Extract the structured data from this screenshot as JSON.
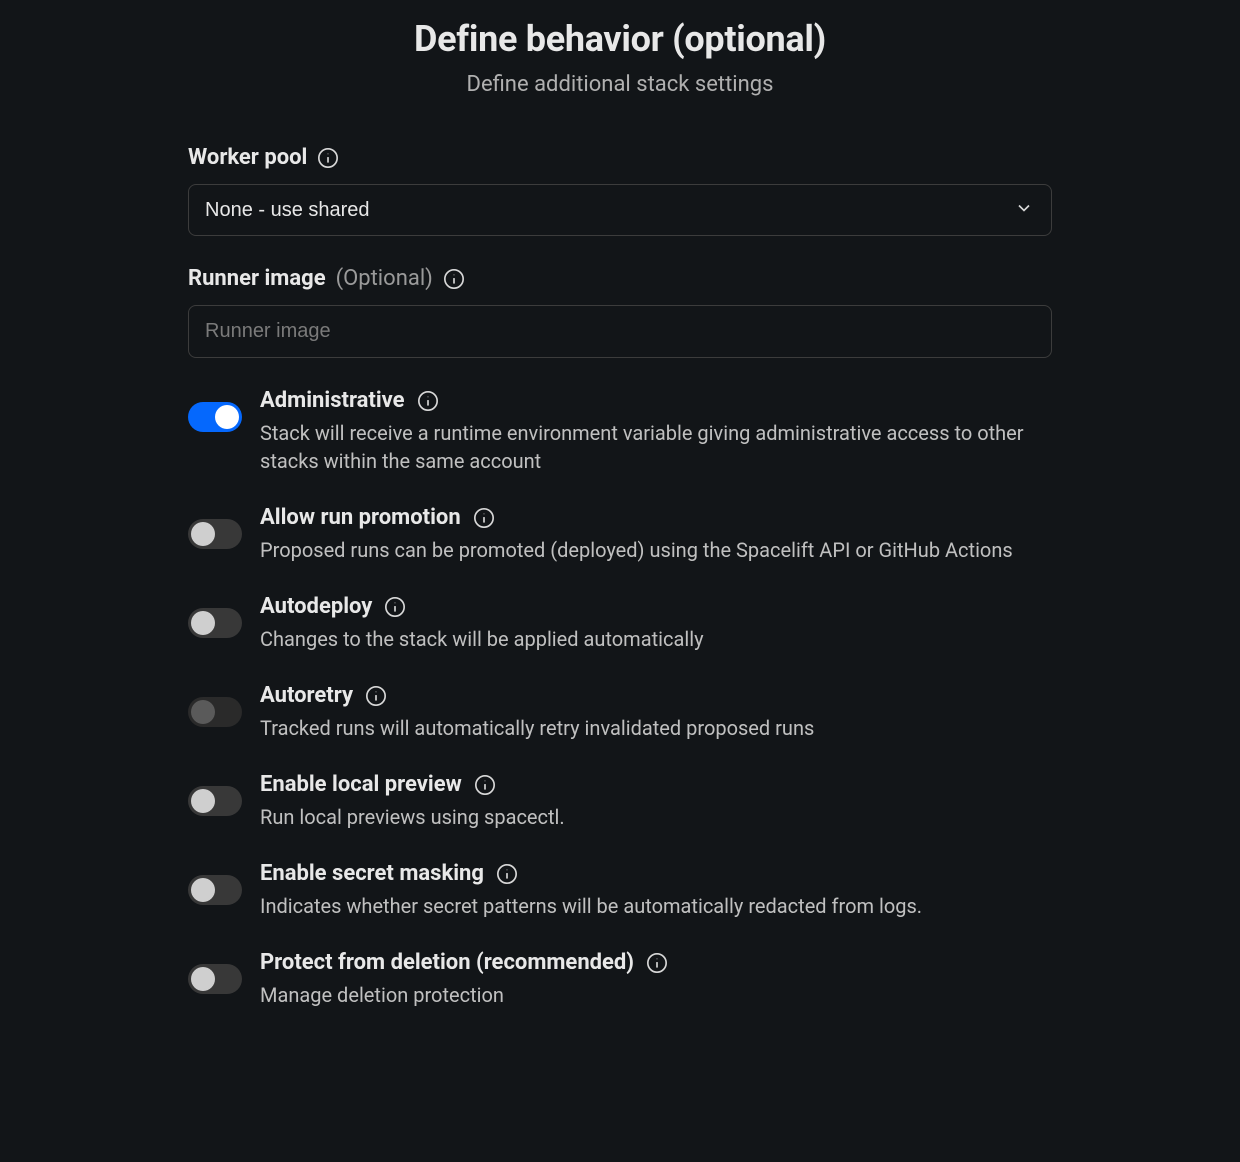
{
  "header": {
    "title": "Define behavior (optional)",
    "subtitle": "Define additional stack settings"
  },
  "workerPool": {
    "label": "Worker pool",
    "selected": "None - use shared"
  },
  "runnerImage": {
    "label": "Runner image",
    "optional": "(Optional)",
    "placeholder": "Runner image",
    "value": ""
  },
  "toggles": [
    {
      "key": "administrative",
      "title": "Administrative",
      "desc": "Stack will receive a runtime environment variable giving administrative access to other stacks within the same account",
      "state": "on"
    },
    {
      "key": "allow-run-promotion",
      "title": "Allow run promotion",
      "desc": "Proposed runs can be promoted (deployed) using the Spacelift API or GitHub Actions",
      "state": "off"
    },
    {
      "key": "autodeploy",
      "title": "Autodeploy",
      "desc": "Changes to the stack will be applied automatically",
      "state": "off"
    },
    {
      "key": "autoretry",
      "title": "Autoretry",
      "desc": "Tracked runs will automatically retry invalidated proposed runs",
      "state": "disabled"
    },
    {
      "key": "enable-local-preview",
      "title": "Enable local preview",
      "desc": "Run local previews using spacectl.",
      "state": "off"
    },
    {
      "key": "enable-secret-masking",
      "title": "Enable secret masking",
      "desc": "Indicates whether secret patterns will be automatically redacted from logs.",
      "state": "off"
    },
    {
      "key": "protect-from-deletion",
      "title": "Protect from deletion (recommended)",
      "desc": "Manage deletion protection",
      "state": "off"
    }
  ]
}
